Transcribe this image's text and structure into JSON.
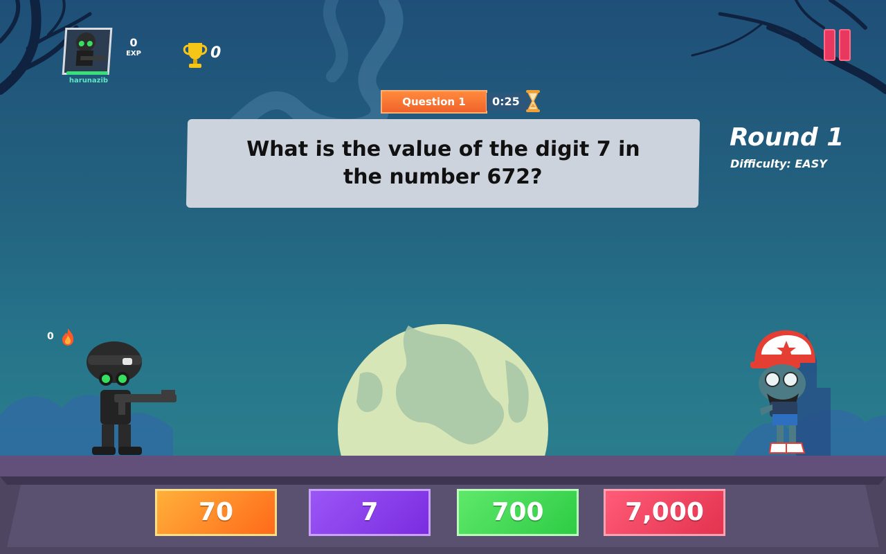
{
  "hud": {
    "username": "harunazib",
    "exp_value": "0",
    "exp_label": "EXP",
    "trophies": "0"
  },
  "question": {
    "tag": "Question 1",
    "timer": "0:25",
    "text": "What is the value of the digit 7 in the number 672?"
  },
  "round": {
    "title": "Round 1",
    "difficulty": "Difficulty: EASY"
  },
  "player": {
    "streak": "0",
    "health_fraction": 1.0
  },
  "answers": [
    {
      "label": "70",
      "color": "#ff8a2a"
    },
    {
      "label": "7",
      "color": "#8a3fea"
    },
    {
      "label": "700",
      "color": "#3ad650"
    },
    {
      "label": "7,000",
      "color": "#ee4562"
    }
  ],
  "colors": {
    "sky_top": "#1f4f78",
    "ground": "#5a4e6e",
    "accent_orange": "#f0632a",
    "pause_red": "#e8385f"
  },
  "icons": {
    "trophy": "trophy-icon",
    "hourglass": "hourglass-icon",
    "flame": "flame-icon",
    "pause": "pause-icon"
  }
}
